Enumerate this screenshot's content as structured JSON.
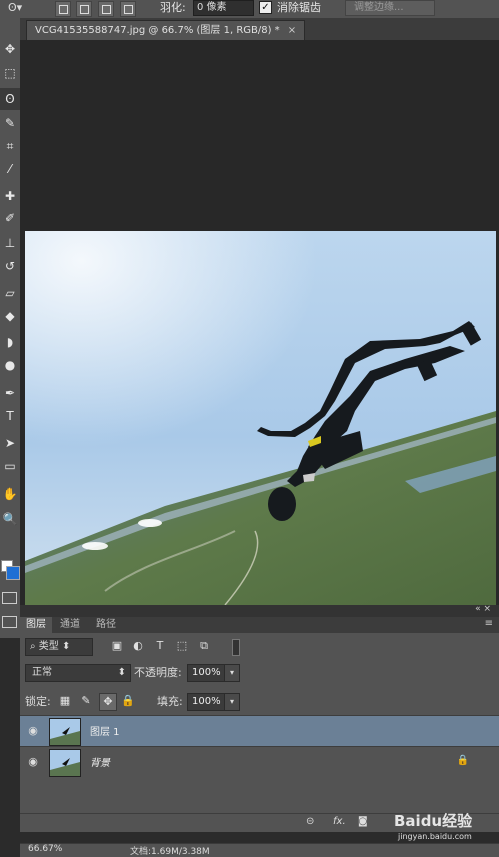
{
  "options_bar": {
    "feather_label": "羽化:",
    "feather_value": "0 像素",
    "antialias_label": "消除锯齿",
    "antialias_checked": true,
    "refine_edge_label": "调整边缘..."
  },
  "document": {
    "tab_title": "VCG41535588747.jpg @ 66.7% (图层 1, RGB/8) *",
    "close_glyph": "×"
  },
  "tools": [
    {
      "name": "move-tool",
      "glyph": "✥"
    },
    {
      "name": "marquee-tool",
      "glyph": "⬚"
    },
    {
      "name": "lasso-tool",
      "glyph": "ʘ",
      "selected": true
    },
    {
      "name": "quick-selection-tool",
      "glyph": "✎"
    },
    {
      "name": "crop-tool",
      "glyph": "⌗"
    },
    {
      "name": "eyedropper-tool",
      "glyph": "⁄"
    },
    {
      "name": "healing-brush-tool",
      "glyph": "✚"
    },
    {
      "name": "brush-tool",
      "glyph": "✐"
    },
    {
      "name": "clone-stamp-tool",
      "glyph": "⊥"
    },
    {
      "name": "history-brush-tool",
      "glyph": "↺"
    },
    {
      "name": "eraser-tool",
      "glyph": "▱"
    },
    {
      "name": "paint-bucket-tool",
      "glyph": "◆"
    },
    {
      "name": "blur-tool",
      "glyph": "◗"
    },
    {
      "name": "dodge-tool",
      "glyph": "●"
    },
    {
      "name": "pen-tool",
      "glyph": "✒"
    },
    {
      "name": "type-tool",
      "glyph": "T"
    },
    {
      "name": "path-selection-tool",
      "glyph": "➤"
    },
    {
      "name": "shape-tool",
      "glyph": "▭"
    },
    {
      "name": "hand-tool",
      "glyph": "✋"
    },
    {
      "name": "zoom-tool",
      "glyph": "🔍"
    }
  ],
  "colors": {
    "foreground": "#ffffff",
    "background": "#1e6fd4"
  },
  "layers_panel": {
    "tabs": [
      "图层",
      "通道",
      "路径"
    ],
    "active_tab": "图层",
    "menu_glyph": "≡",
    "filter_kind": "类型",
    "blend_mode": "正常",
    "opacity_label": "不透明度:",
    "opacity_value": "100%",
    "lock_label": "锁定:",
    "fill_label": "填充:",
    "fill_value": "100%",
    "layers": [
      {
        "name": "图层 1",
        "selected": true,
        "visible": true,
        "locked": false
      },
      {
        "name": "背景",
        "selected": false,
        "visible": true,
        "locked": true
      }
    ],
    "footer_icons": [
      "link-icon",
      "fx-icon",
      "mask-icon"
    ]
  },
  "status": {
    "zoom": "66.67%",
    "doc_info": "文档:1.69M/3.38M"
  },
  "watermark": {
    "text": "Baidu经验",
    "sub": "jingyan.baidu.com"
  }
}
